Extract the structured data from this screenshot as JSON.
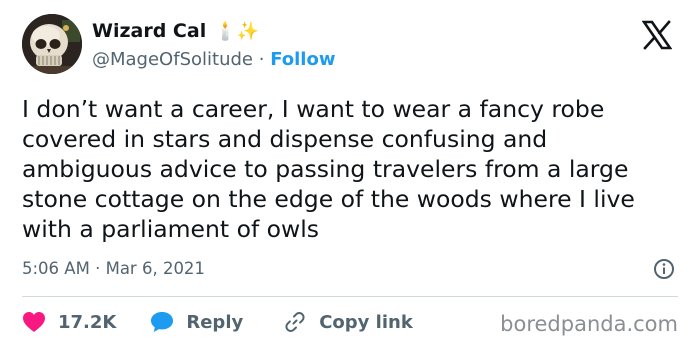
{
  "author": {
    "display_name": "Wizard Cal",
    "name_emoji": "🕯️✨",
    "handle": "@MageOfSolitude",
    "separator": "·",
    "follow_label": "Follow"
  },
  "tweet": {
    "text": "I don’t want a career, I want to wear a fancy robe covered in stars and dispense confusing and ambiguous advice to passing travelers from a large stone cottage on the edge of the woods where I live with a parliament of owls",
    "time": "5:06 AM",
    "date_separator": "·",
    "date": "Mar 6, 2021"
  },
  "actions": {
    "likes_count": "17.2K",
    "reply_label": "Reply",
    "copy_link_label": "Copy link"
  },
  "icons": {
    "brand_logo": "x-logo-icon",
    "like": "heart-icon",
    "reply": "speech-bubble-icon",
    "copy_link": "link-icon",
    "info": "info-icon"
  },
  "colors": {
    "accent": "#1d9bf0",
    "like": "#f91880",
    "muted_text": "#536471"
  },
  "watermark": "boredpanda.com"
}
